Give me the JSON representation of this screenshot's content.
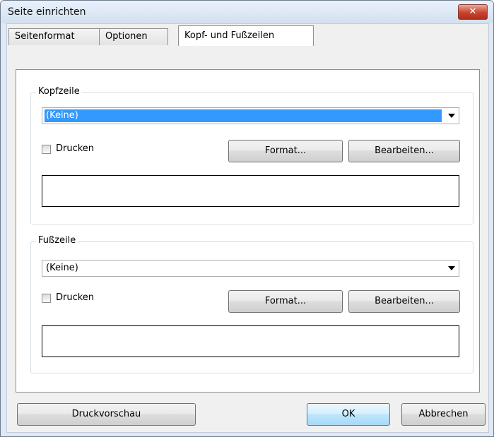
{
  "dialog": {
    "title": "Seite einrichten",
    "close_label": "✕"
  },
  "tabs": [
    {
      "label": "Seitenformat"
    },
    {
      "label": "Optionen"
    },
    {
      "label": "Kopf- und Fußzeilen"
    }
  ],
  "header_section": {
    "label": "Kopfzeile",
    "combo_value": "(Keine)",
    "print_label": "Drucken",
    "print_checked": false,
    "format_label": "Format...",
    "edit_label": "Bearbeiten..."
  },
  "footer_section": {
    "label": "Fußzeile",
    "combo_value": "(Keine)",
    "print_label": "Drucken",
    "print_checked": false,
    "format_label": "Format...",
    "edit_label": "Bearbeiten..."
  },
  "buttons": {
    "preview_label": "Druckvorschau",
    "ok_label": "OK",
    "cancel_label": "Abbrechen"
  }
}
